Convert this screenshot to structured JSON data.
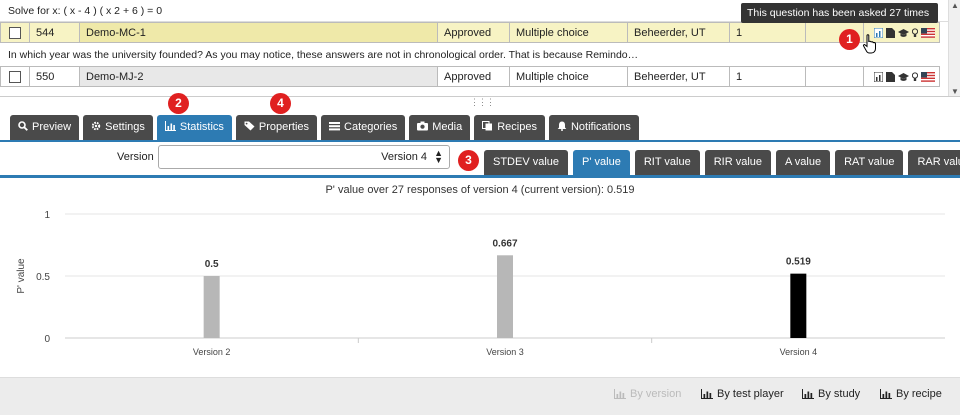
{
  "questions": {
    "formula": "Solve for x: ( x - 4 ) ( x 2 + 6 ) = 0",
    "rows": [
      {
        "id": "544",
        "name": "Demo-MC-1",
        "status": "Approved",
        "type": "Multiple choice",
        "owner": "Beheerder, UT",
        "count": "1"
      },
      {
        "id": "550",
        "name": "Demo-MJ-2",
        "status": "Approved",
        "type": "Multiple choice",
        "owner": "Beheerder, UT",
        "count": "1"
      }
    ],
    "description": "In which year was the university founded? As you may notice, these answers are not in chronological order. That is because Remindo…",
    "tooltip": "This question has been asked 27 times"
  },
  "markers": [
    "1",
    "2",
    "3",
    "4"
  ],
  "tabs": [
    {
      "label": "Preview",
      "icon": "search-icon"
    },
    {
      "label": "Settings",
      "icon": "gear-icon"
    },
    {
      "label": "Statistics",
      "icon": "bar-chart-icon"
    },
    {
      "label": "Properties",
      "icon": "tag-icon"
    },
    {
      "label": "Categories",
      "icon": "list-icon"
    },
    {
      "label": "Media",
      "icon": "camera-icon"
    },
    {
      "label": "Recipes",
      "icon": "copy-icon"
    },
    {
      "label": "Notifications",
      "icon": "bell-icon"
    }
  ],
  "version": {
    "label": "Version",
    "selected": "Version 4"
  },
  "metrics": [
    "STDEV value",
    "P' value",
    "RIT value",
    "RIR value",
    "A value",
    "RAT value",
    "RAR value"
  ],
  "chart_data": {
    "type": "bar",
    "title": "P' value over 27 responses of version 4 (current version): 0.519",
    "categories": [
      "Version 2",
      "Version 3",
      "Version 4"
    ],
    "values": [
      0.5,
      0.667,
      0.519
    ],
    "value_labels": [
      "0.5",
      "0.667",
      "0.519"
    ],
    "bar_colors": [
      "#b7b7b7",
      "#b7b7b7",
      "#000000"
    ],
    "ylabel": "P' value",
    "ylim": [
      0,
      1
    ],
    "yticks": [
      "0",
      "0.5",
      "1"
    ],
    "grid": true
  },
  "bottom": [
    {
      "label": "By version",
      "disabled": true
    },
    {
      "label": "By test player",
      "disabled": false
    },
    {
      "label": "By study",
      "disabled": false
    },
    {
      "label": "By recipe",
      "disabled": false
    }
  ],
  "colors": {
    "accent": "#2d7bb3",
    "tab_dark": "#4a4a4a",
    "marker": "#e02020",
    "selected_row": "#f7f3c4"
  }
}
